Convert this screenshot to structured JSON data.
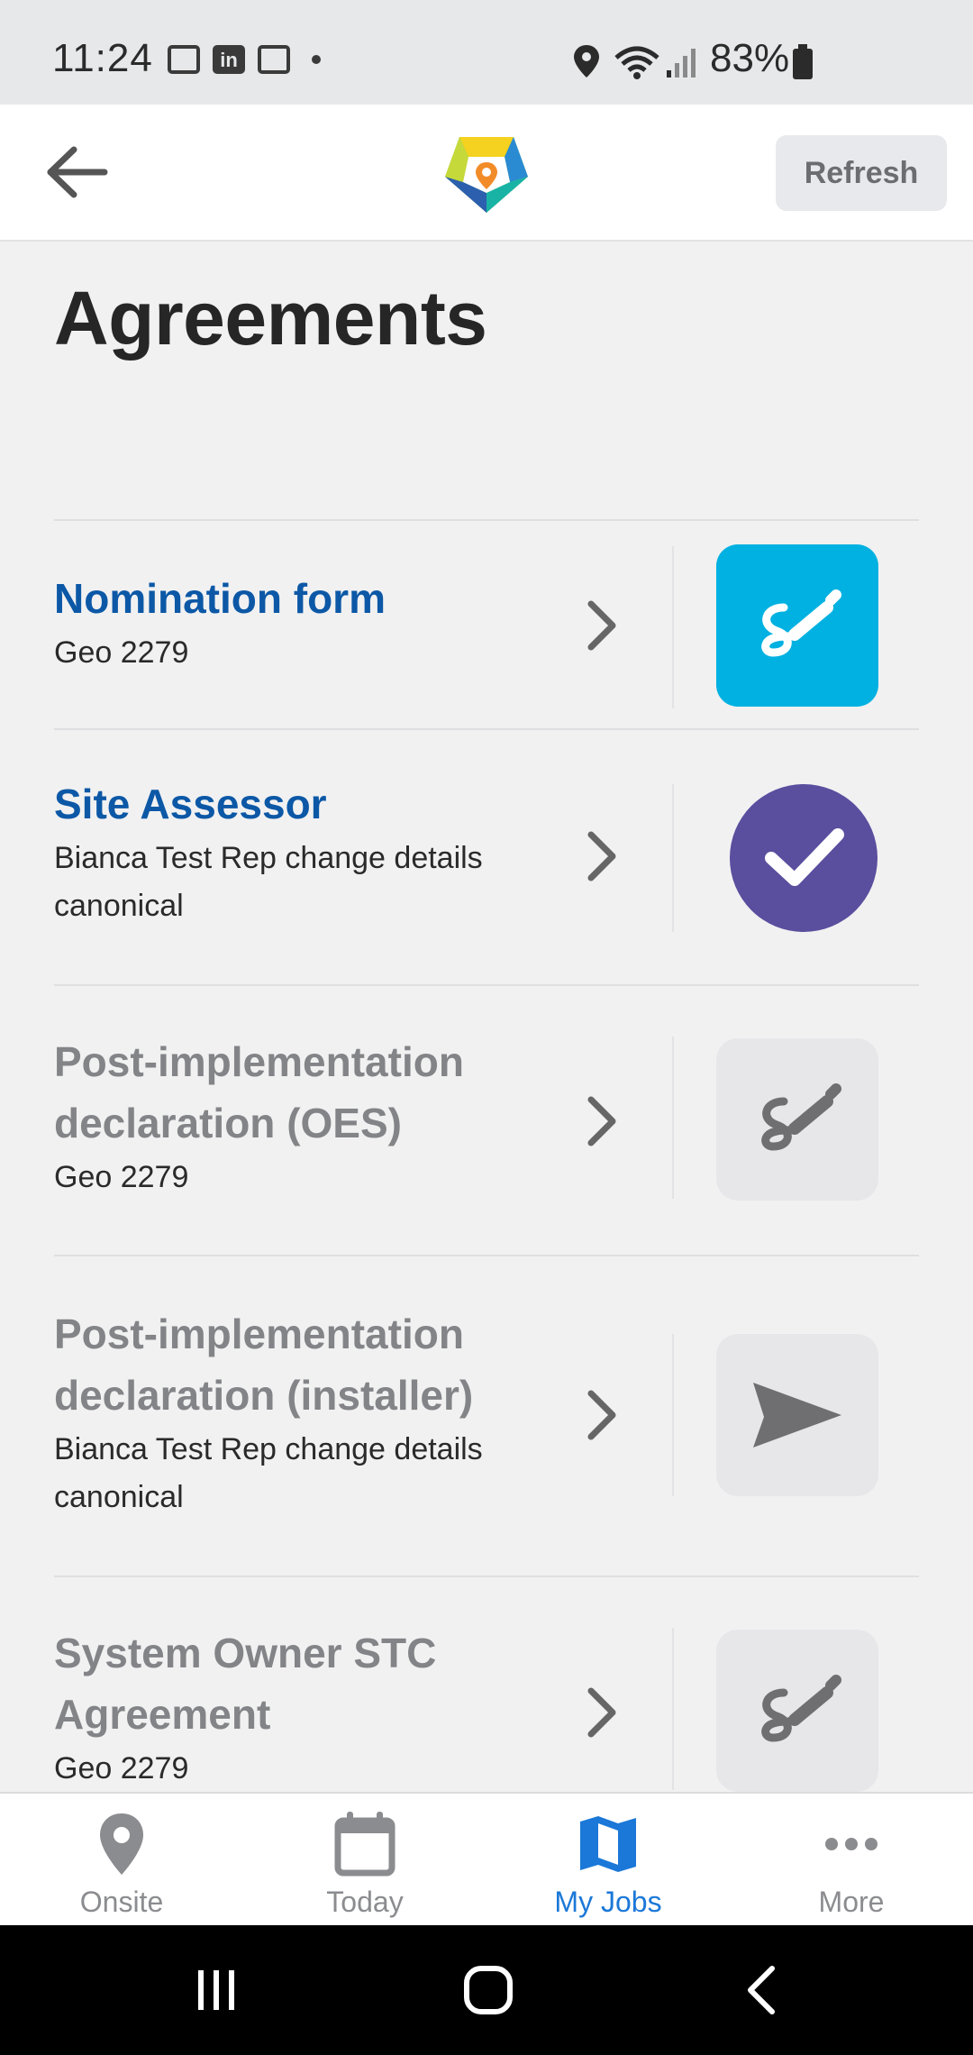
{
  "status_bar": {
    "time": "11:24",
    "battery": "83%",
    "icons": [
      "outlook-icon",
      "linkedin-icon",
      "outlook-icon",
      "location-icon",
      "wifi-icon",
      "signal-icon",
      "battery-icon"
    ]
  },
  "header": {
    "refresh_label": "Refresh",
    "back_icon": "arrow-left-icon",
    "logo_icon": "app-logo-icon"
  },
  "page": {
    "title": "Agreements"
  },
  "agreements": [
    {
      "title": "Nomination form",
      "subtitle": "Geo 2279",
      "state": "active",
      "action_icon": "sign-icon"
    },
    {
      "title": "Site Assessor",
      "subtitle": "Bianca Test Rep change details canonical",
      "state": "active",
      "action_icon": "check-icon"
    },
    {
      "title": "Post-implementation declaration (OES)",
      "subtitle": "Geo 2279",
      "state": "inactive",
      "action_icon": "sign-icon"
    },
    {
      "title": "Post-implementation declaration (installer)",
      "subtitle": "Bianca Test Rep change details canonical",
      "state": "inactive",
      "action_icon": "send-icon"
    },
    {
      "title": "System Owner STC Agreement",
      "subtitle": "Geo 2279",
      "state": "inactive",
      "action_icon": "sign-icon"
    }
  ],
  "bottom_nav": [
    {
      "label": "Onsite",
      "icon": "location-pin-icon",
      "active": false
    },
    {
      "label": "Today",
      "icon": "calendar-icon",
      "active": false
    },
    {
      "label": "My Jobs",
      "icon": "map-icon",
      "active": true
    },
    {
      "label": "More",
      "icon": "more-dots-icon",
      "active": false
    }
  ],
  "colors": {
    "link_blue": "#0c58a6",
    "tile_blue": "#00b1e1",
    "check_purple": "#5a4e9e",
    "nav_active": "#1b78d8"
  }
}
